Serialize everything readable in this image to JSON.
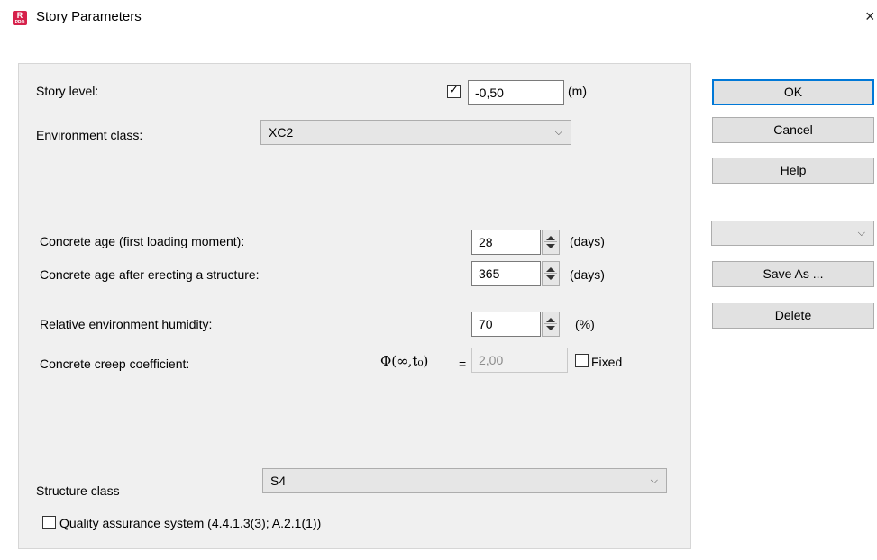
{
  "window": {
    "title": "Story Parameters",
    "icon_text": "R",
    "icon_subtext": "PRO",
    "close_glyph": "×"
  },
  "story_level": {
    "label": "Story level:",
    "checked": true,
    "value": "-0,50",
    "unit": "(m)"
  },
  "environment_class": {
    "label": "Environment class:",
    "selected": "XC2"
  },
  "concrete_age_first": {
    "label": "Concrete age (first loading moment):",
    "value": "28",
    "unit": "(days)"
  },
  "concrete_age_after": {
    "label": "Concrete age after erecting a structure:",
    "value": "365",
    "unit": "(days)"
  },
  "humidity": {
    "label": "Relative environment humidity:",
    "value": "70",
    "unit": "(%)"
  },
  "creep": {
    "label": "Concrete creep coefficient:",
    "symbol": "Φ(∞,t₀)",
    "equals": "=",
    "value": "2,00",
    "fixed_label": "Fixed",
    "fixed_checked": false
  },
  "structure_class": {
    "label": "Structure class",
    "selected": "S4"
  },
  "quality_assurance": {
    "label": "Quality assurance system (4.4.1.3(3); A.2.1(1))",
    "checked": false
  },
  "buttons": {
    "ok": "OK",
    "cancel": "Cancel",
    "help": "Help",
    "save_as": "Save As ...",
    "delete": "Delete"
  },
  "preset_combo": {
    "selected": ""
  },
  "glyphs": {
    "chevron": "⌵",
    "checkmark": "✓"
  },
  "colors": {
    "accent": "#0078d7",
    "app_icon": "#d6214b",
    "panel_bg": "#f0f0f0"
  }
}
